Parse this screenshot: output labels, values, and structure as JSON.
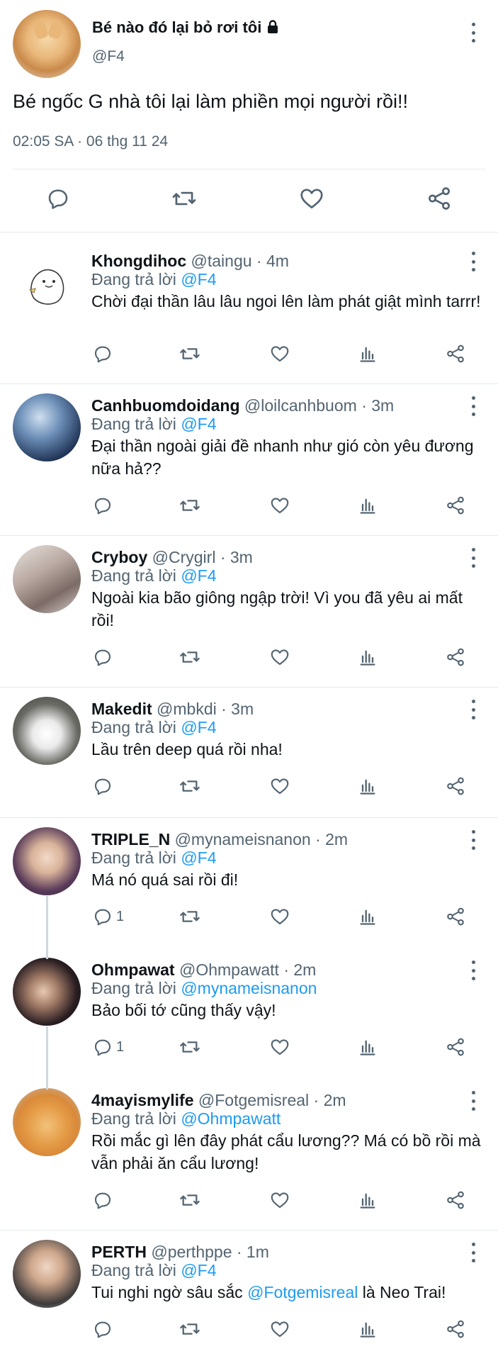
{
  "main_tweet": {
    "author_name": "Bé nào đó lại bỏ rơi tôi",
    "author_handle": "@F4",
    "text": "Bé ngốc G nhà tôi lại làm phiền mọi người rồi!!",
    "timestamp": "02:05 SA · 06 thg 11 24",
    "icons": {
      "lock": "lock-icon",
      "more": "more-vertical-icon",
      "reply": "reply-icon",
      "retweet": "retweet-icon",
      "like": "heart-icon",
      "share": "share-icon"
    }
  },
  "reply_label": "Đang trả lời",
  "replies": [
    {
      "name": "Khongdihoc",
      "handle": "@taingu · 4m",
      "replying_to": "@F4",
      "text": "Chời đại thần lâu lâu ngoi lên làm phát giật mình tarrr!",
      "reply_count": ""
    },
    {
      "name": "Canhbuomdoidang",
      "handle": "@loilcanhbuom · 3m",
      "replying_to": "@F4",
      "text": "Đại thần ngoài giải đề nhanh như gió còn yêu đương nữa hả??",
      "reply_count": ""
    },
    {
      "name": "Cryboy",
      "handle": "@Crygirl · 3m",
      "replying_to": "@F4",
      "text": "Ngoài kia bão giông ngập trời! Vì you đã yêu ai mất rồi!",
      "reply_count": ""
    },
    {
      "name": "Makedit",
      "handle": "@mbkdi · 3m",
      "replying_to": "@F4",
      "text": "Lầu trên deep quá rồi nha!",
      "reply_count": ""
    },
    {
      "name": "TRIPLE_N",
      "handle": "@mynameisnanon · 2m",
      "replying_to": "@F4",
      "text": "Má nó quá sai rồi đi!",
      "reply_count": "1"
    },
    {
      "name": "Ohmpawat",
      "handle": "@Ohmpawatt · 2m",
      "replying_to": "@mynameisnanon",
      "text": "Bảo bối tớ cũng thấy vậy!",
      "reply_count": "1"
    },
    {
      "name": "4mayismylife",
      "handle": "@Fotgemisreal · 2m",
      "replying_to": "@Ohmpawatt",
      "text": "Rồi mắc gì lên đây phát cẩu lương?? Má có bồ rồi mà vẫn phải ăn cẩu lương!",
      "reply_count": ""
    },
    {
      "name": "PERTH",
      "handle": "@perthppe · 1m",
      "replying_to": "@F4",
      "text_before": "Tui nghi ngờ sâu sắc ",
      "text_mention": "@Fotgemisreal",
      "text_after": " là Neo Trai!",
      "reply_count": ""
    }
  ],
  "colors": {
    "text": "#0f1419",
    "secondary": "#536471",
    "accent": "#1d9bf0",
    "divider": "#e6e9ec"
  }
}
